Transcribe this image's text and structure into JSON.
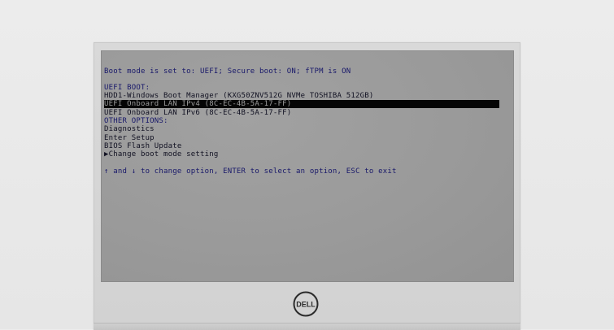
{
  "bios": {
    "boot_mode": "Boot mode is set to: UEFI; Secure boot: ON; fTPM is ON",
    "uefi_boot_header": "UEFI BOOT:",
    "uefi_items": [
      "HDD1-Windows Boot Manager (KXG50ZNV512G NVMe TOSHIBA 512GB)",
      "UEFI Onboard LAN IPv4 (8C-EC-4B-5A-17-FF)",
      "UEFI Onboard LAN IPv6 (8C-EC-4B-5A-17-FF)"
    ],
    "other_options_header": "OTHER OPTIONS:",
    "other_items": [
      "Diagnostics",
      "Enter Setup",
      "BIOS Flash Update",
      "▶Change boot mode setting"
    ],
    "instructions": "↑ and ↓ to change option, ENTER to select an option, ESC to exit"
  },
  "brand": {
    "logo_text": "DELL",
    "logo_icon": "dell-logo-icon"
  },
  "colors": {
    "screen_bg": "#9a9a9a",
    "header_text": "#18186a",
    "item_text": "#111122",
    "highlight_bg": "#050505",
    "highlight_text": "#9c9c9c",
    "bezel": "#d6d6d6"
  }
}
